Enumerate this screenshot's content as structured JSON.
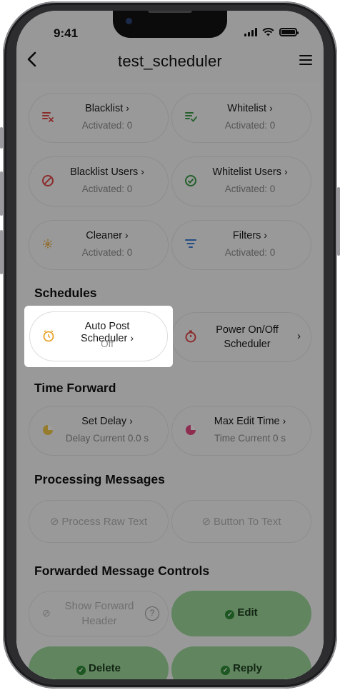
{
  "status": {
    "time": "9:41"
  },
  "nav": {
    "title": "test_scheduler",
    "back_icon": "chevron-left-icon",
    "menu_icon": "hamburger-icon"
  },
  "filter_cards": [
    {
      "label": "Blacklist",
      "sub": "Activated: 0",
      "icon": "blacklist-icon",
      "color": "#e24a4a"
    },
    {
      "label": "Whitelist",
      "sub": "Activated: 0",
      "icon": "whitelist-icon",
      "color": "#3e9c4a"
    },
    {
      "label": "Blacklist Users",
      "sub": "Activated: 0",
      "icon": "ban-icon",
      "color": "#e24a4a"
    },
    {
      "label": "Whitelist Users",
      "sub": "Activated: 0",
      "icon": "check-circle-icon",
      "color": "#3e9c4a"
    },
    {
      "label": "Cleaner",
      "sub": "Activated: 0",
      "icon": "sparkle-icon",
      "color": "#e8a32a"
    },
    {
      "label": "Filters",
      "sub": "Activated: 0",
      "icon": "filter-icon",
      "color": "#3a7bd5"
    }
  ],
  "sections": {
    "schedules": "Schedules",
    "time_forward": "Time Forward",
    "processing": "Processing Messages",
    "forwarded": "Forwarded Message Controls"
  },
  "schedules": {
    "auto_post": {
      "label": "Auto Post Scheduler",
      "sub": "Off",
      "icon": "clock-icon",
      "color": "#e8a32a"
    },
    "power": {
      "label": "Power On/Off Scheduler",
      "icon": "stopwatch-icon",
      "color": "#e24a4a"
    }
  },
  "time_forward": {
    "delay": {
      "label": "Set Delay",
      "sub": "Delay Current 0.0 s",
      "icon": "pie-icon",
      "color": "#e8a32a"
    },
    "edit": {
      "label": "Max Edit Time",
      "sub": "Time Current 0 s",
      "icon": "pie-icon",
      "color": "#d6336c"
    }
  },
  "processing": {
    "raw": "Process Raw Text",
    "button": "Button To Text"
  },
  "forwarded": {
    "show_header": "Show Forward Header",
    "edit": "Edit",
    "delete": "Delete",
    "reply": "Reply",
    "help_icon": "question-circle-icon"
  }
}
